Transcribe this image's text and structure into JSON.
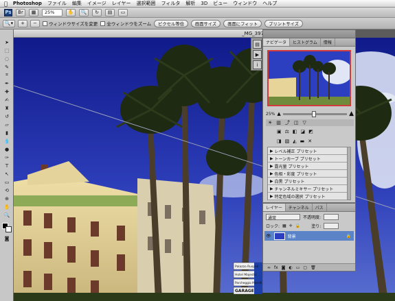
{
  "menubar": {
    "apple": "",
    "items": [
      "Photoshop",
      "ファイル",
      "編集",
      "イメージ",
      "レイヤー",
      "選択範囲",
      "フィルタ",
      "解析",
      "3D",
      "ビュー",
      "ウィンドウ",
      "ヘルプ"
    ]
  },
  "appbar": {
    "logo": "Ps",
    "zoom": "25%"
  },
  "options": {
    "resize_windows": "ウィンドウサイズを変更",
    "zoom_all": "全ウィンドウをズーム",
    "buttons": [
      "ピクセル等倍",
      "画面サイズ",
      "画面にフィット",
      "プリントサイズ"
    ]
  },
  "document": {
    "title": "_MG_397"
  },
  "navigator": {
    "tabs": [
      "ナビゲータ",
      "ヒストグラム",
      "情報"
    ],
    "zoom": "25%"
  },
  "adjustments": {
    "items": [
      "レベル補正 プリセット",
      "トーンカーブ プリセット",
      "露光量 プリセット",
      "色相・彩度 プリセット",
      "白黒 プリセット",
      "チャンネルミキサー プリセット",
      "特定色域の選択 プリセット"
    ]
  },
  "layers": {
    "tabs": [
      "レイヤー",
      "チャンネル",
      "パス"
    ],
    "blend_mode": "通常",
    "opacity_label": "不透明度:",
    "lock_label": "ロック:",
    "fill_label": "塗り:",
    "layer_name": "背景"
  },
  "signs": [
    "Palazzo Ruspoli",
    "Hotel Majestic",
    "Parcheggio Morelli",
    "GARAGE"
  ],
  "colors": {
    "sky": "#1c2ba8",
    "accent": "#d13b3b"
  }
}
